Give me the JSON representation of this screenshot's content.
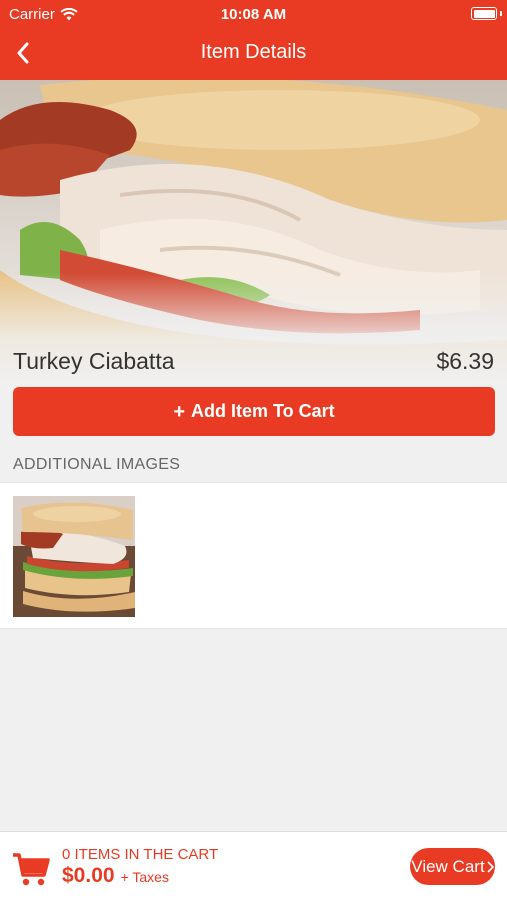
{
  "status_bar": {
    "carrier": "Carrier",
    "time": "10:08 AM"
  },
  "nav": {
    "title": "Item Details"
  },
  "item": {
    "name": "Turkey Ciabatta",
    "price": "$6.39"
  },
  "actions": {
    "add_to_cart_label": "Add Item To Cart"
  },
  "additional_images": {
    "title": "ADDITIONAL IMAGES"
  },
  "cart": {
    "items_text": "0 ITEMS IN THE CART",
    "total": "$0.00",
    "taxes_label": "+ Taxes",
    "view_cart_label": "View Cart"
  },
  "colors": {
    "accent": "#e93b23",
    "background": "#f0f0f0"
  }
}
